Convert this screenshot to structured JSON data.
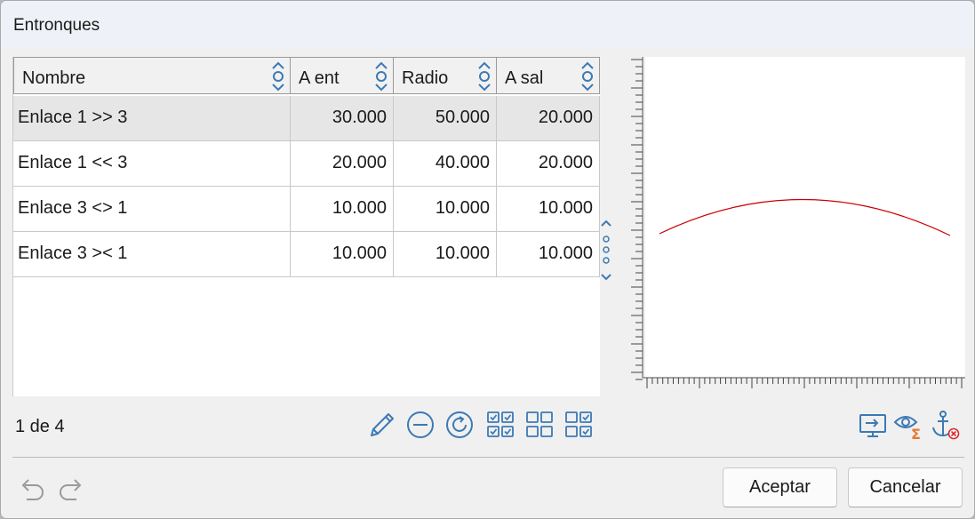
{
  "window": {
    "title": "Entronques"
  },
  "table": {
    "columns": [
      "Nombre",
      "A ent",
      "Radio",
      "A sal"
    ],
    "rows": [
      {
        "name": "Enlace 1 >> 3",
        "a_ent": "30.000",
        "radio": "50.000",
        "a_sal": "20.000",
        "selected": true
      },
      {
        "name": "Enlace 1 << 3",
        "a_ent": "20.000",
        "radio": "40.000",
        "a_sal": "20.000",
        "selected": false
      },
      {
        "name": "Enlace 3 <> 1",
        "a_ent": "10.000",
        "radio": "10.000",
        "a_sal": "10.000",
        "selected": false
      },
      {
        "name": "Enlace 3 >< 1",
        "a_ent": "10.000",
        "radio": "10.000",
        "a_sal": "10.000",
        "selected": false
      }
    ]
  },
  "pager": {
    "text": "1 de 4"
  },
  "toolbar": {
    "icons": [
      "pencil-icon",
      "remove-circle-icon",
      "refresh-icon",
      "check-all-icon",
      "uncheck-all-icon",
      "invert-check-icon"
    ]
  },
  "preview": {
    "curve_color": "#cc0000",
    "icons": [
      "export-view-icon",
      "view-sum-icon",
      "anchor-remove-icon"
    ]
  },
  "buttons": {
    "accept": "Aceptar",
    "cancel": "Cancelar"
  },
  "history": {
    "icons": [
      "undo-icon",
      "redo-icon"
    ]
  },
  "colors": {
    "accent": "#3d79b5",
    "orange": "#e8762b",
    "red": "#d9282f"
  }
}
